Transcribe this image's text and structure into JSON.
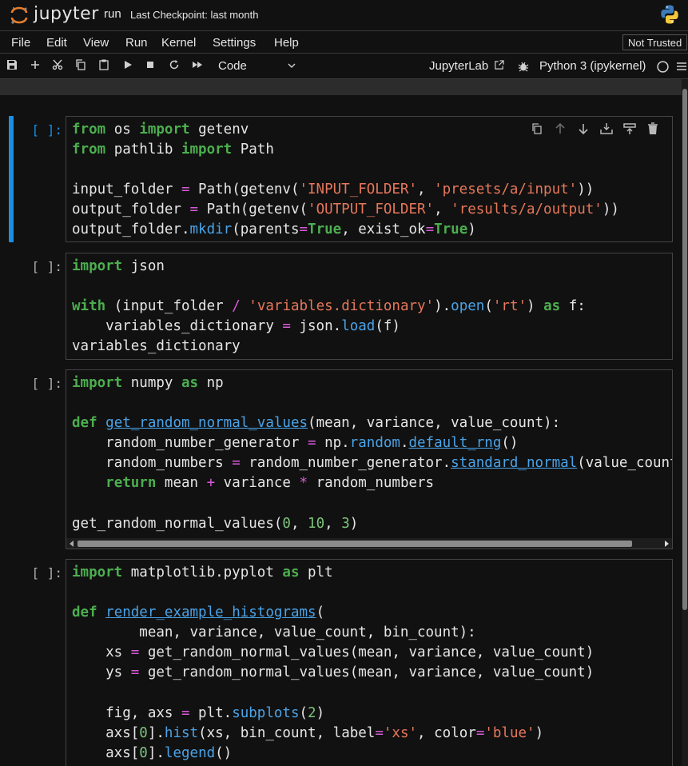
{
  "app": {
    "logo_text": "jupyter",
    "notebook_name": "run",
    "checkpoint": "Last Checkpoint: last month",
    "trust_status": "Not Trusted"
  },
  "menu": [
    "File",
    "Edit",
    "View",
    "Run",
    "Kernel",
    "Settings",
    "Help"
  ],
  "toolbar": {
    "cell_type": "Code",
    "jupyterlab_link": "JupyterLab",
    "kernel": "Python 3 (ipykernel)",
    "icons": [
      "save-icon",
      "add-cell-icon",
      "cut-icon",
      "copy-icon",
      "paste-icon",
      "run-icon",
      "stop-icon",
      "restart-icon",
      "fast-forward-icon"
    ]
  },
  "cells": [
    {
      "prompt": "[ ]:",
      "active": true
    },
    {
      "prompt": "[ ]:",
      "active": false
    },
    {
      "prompt": "[ ]:",
      "active": false
    },
    {
      "prompt": "[ ]:",
      "active": false
    }
  ],
  "colors": {
    "accent": "#1a8fe3",
    "keyword": "#4cae4f",
    "string": "#e6775a",
    "operator": "#d85ad8",
    "number": "#7cc37c",
    "builtin_attr": "#4aa3e8"
  }
}
